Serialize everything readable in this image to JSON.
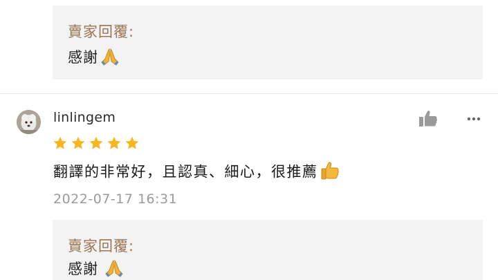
{
  "colors": {
    "reply_bg": "#f4f3f3",
    "reply_label": "#9a7453",
    "star": "#f7b521",
    "timestamp": "#9a9a9a",
    "icon": "#9a9a9a"
  },
  "top_reply": {
    "label": "賣家回覆:",
    "text": "感謝",
    "emoji": "folded-hands"
  },
  "review": {
    "username": "linlingem",
    "rating": 5,
    "rating_max": 5,
    "text": "翻譯的非常好，且認真、細心，很推薦",
    "text_emoji": "thumbs-up",
    "timestamp": "2022-07-17 16:31",
    "like_icon": "thumbs-up-icon",
    "more_icon": "more-icon"
  },
  "bottom_reply": {
    "label": "賣家回覆:",
    "text": "感謝",
    "emoji": "folded-hands"
  }
}
